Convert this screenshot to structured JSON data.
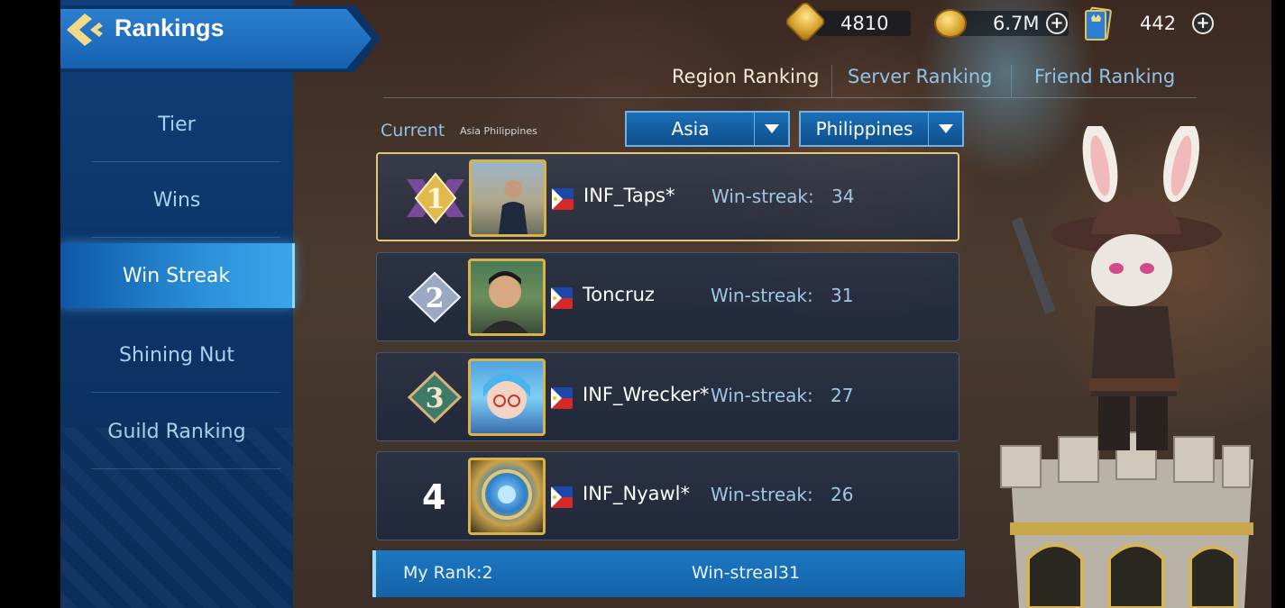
{
  "header": {
    "title": "Rankings",
    "currencies": [
      {
        "icon": "medal-coin-icon",
        "value": "4810"
      },
      {
        "icon": "gold-coin-icon",
        "value": "6.7M"
      },
      {
        "icon": "ticket-card-icon",
        "value": "442"
      }
    ]
  },
  "sidebar": {
    "items": [
      {
        "label": "Tier"
      },
      {
        "label": "Wins"
      },
      {
        "label": "Win Streak"
      },
      {
        "label": "Shining Nut"
      },
      {
        "label": "Guild Ranking"
      }
    ],
    "active_index": 2
  },
  "ranking_tabs": [
    {
      "label": "Region Ranking",
      "active": true
    },
    {
      "label": "Server Ranking",
      "active": false
    },
    {
      "label": "Friend Ranking",
      "active": false
    }
  ],
  "filter": {
    "current_label": "Current",
    "current_value": "Asia Philippines",
    "region": "Asia",
    "country": "Philippines"
  },
  "rows": [
    {
      "rank": "1",
      "name": "INF_Taps*",
      "ws_label": "Win-streak:",
      "ws_value": "34"
    },
    {
      "rank": "2",
      "name": "Toncruz",
      "ws_label": "Win-streak:",
      "ws_value": "31"
    },
    {
      "rank": "3",
      "name": "INF_Wrecker*",
      "ws_label": "Win-streak:",
      "ws_value": "27"
    },
    {
      "rank": "4",
      "name": "INF_Nyawl*",
      "ws_label": "Win-streak:",
      "ws_value": "26"
    }
  ],
  "my_rank": {
    "label": "My Rank:2",
    "win_streak": "Win-streal31"
  },
  "colors": {
    "accent": "#2a8fd7",
    "gold": "#e4c774",
    "sidebar_bg": "#0b3466"
  }
}
